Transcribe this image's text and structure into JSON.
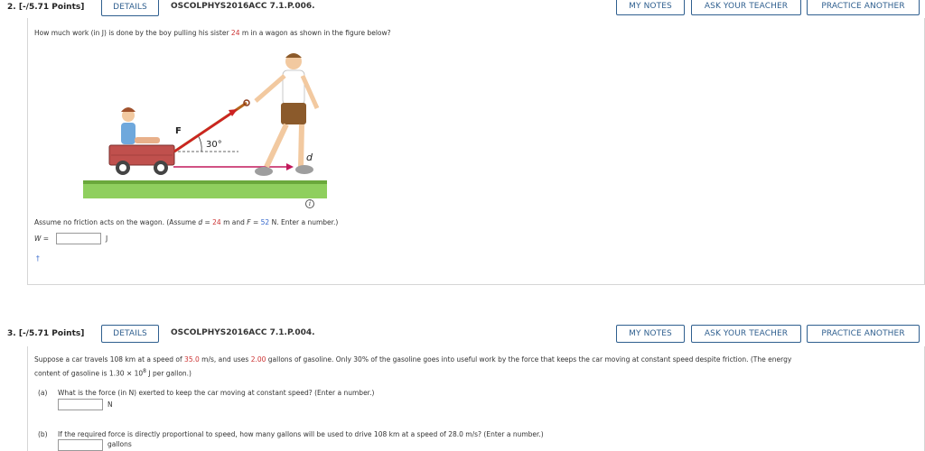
{
  "q2": {
    "number": "2.",
    "points": "[-/5.71 Points]",
    "details_label": "DETAILS",
    "assignment_id": "OSCOLPHYS2016ACC 7.1.P.006.",
    "my_notes_label": "MY NOTES",
    "ask_teacher_label": "ASK YOUR TEACHER",
    "practice_label": "PRACTICE ANOTHER",
    "question_pre": "How much work (in J) is done by the boy pulling his sister ",
    "question_value": "24",
    "question_post": " m in a wagon as shown in the figure below?",
    "figure": {
      "force_label": "F",
      "angle_label": "30°",
      "distance_label": "d",
      "info_icon": "info-icon"
    },
    "assume_pre": "Assume no friction acts on the wagon. (Assume ",
    "assume_d": "d",
    "assume_eq1": " = ",
    "assume_d_value": "24",
    "assume_mid": " m and ",
    "assume_F": "F",
    "assume_eq2": " = ",
    "assume_F_value": "52",
    "assume_post": " N. Enter a number.)",
    "answer_var": "W =",
    "answer_value": "",
    "answer_unit": "J",
    "marker": "†"
  },
  "q3": {
    "number": "3.",
    "points": "[-/5.71 Points]",
    "details_label": "DETAILS",
    "assignment_id": "OSCOLPHYS2016ACC 7.1.P.004.",
    "my_notes_label": "MY NOTES",
    "ask_teacher_label": "ASK YOUR TEACHER",
    "practice_label": "PRACTICE ANOTHER",
    "intro_pre": "Suppose a car travels 108 km at a speed of ",
    "intro_speed": "35.0",
    "intro_mid1": " m/s, and uses ",
    "intro_gallons": "2.00",
    "intro_post": " gallons of gasoline. Only 30% of the gasoline goes into useful work by the force that keeps the car moving at constant speed despite friction. (The energy",
    "intro_line2_pre": "content of gasoline is 1.30 × 10",
    "intro_line2_exp": "8",
    "intro_line2_post": " J per gallon.)",
    "part_a_label": "(a)",
    "part_a_text": "What is the force (in N) exerted to keep the car moving at constant speed? (Enter a number.)",
    "part_a_value": "",
    "part_a_unit": "N",
    "part_b_label": "(b)",
    "part_b_text": "If the required force is directly proportional to speed, how many gallons will be used to drive 108 km at a speed of 28.0 m/s? (Enter a number.)",
    "part_b_value": "",
    "part_b_unit": "gallons"
  },
  "colors": {
    "accent": "#2f5f8f",
    "highlight_red": "#cc3333",
    "ground_green": "#7cc04a",
    "wagon_red": "#c0504d"
  }
}
